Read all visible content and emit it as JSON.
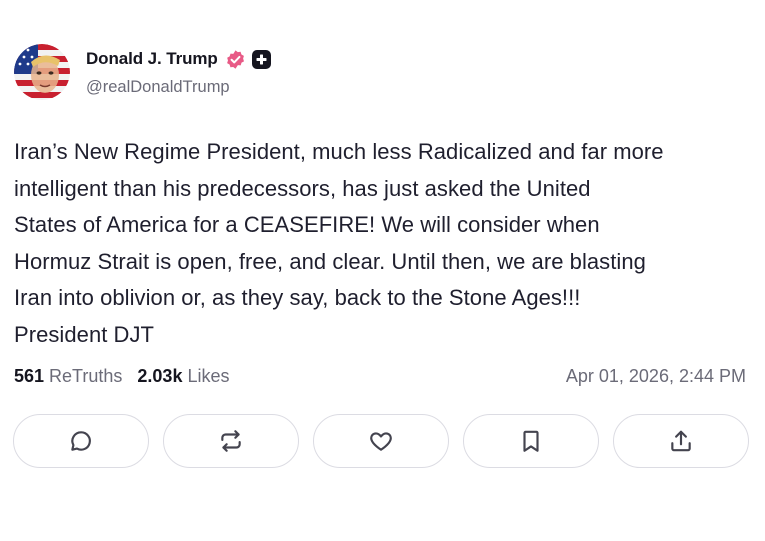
{
  "author": {
    "display_name": "Donald J. Trump",
    "handle": "@realDonaldTrump",
    "verified_icon": "verified-badge-icon",
    "plus_icon": "plus-badge-icon"
  },
  "post": {
    "lines": [
      "Iran’s New Regime President, much less Radicalized and far more",
      "intelligent than his predecessors, has just asked the United",
      "States of America for a CEASEFIRE! We will consider when",
      "Hormuz Strait is open, free, and clear. Until then, we are blasting",
      "Iran into oblivion or, as they say, back to the Stone Ages!!!",
      "President DJT"
    ]
  },
  "stats": {
    "retruths_count": "561",
    "retruths_label": "ReTruths",
    "likes_count": "2.03k",
    "likes_label": "Likes",
    "timestamp": "Apr 01, 2026, 2:44 PM"
  },
  "actions": [
    "reply-icon",
    "retruth-icon",
    "like-icon",
    "bookmark-icon",
    "share-icon"
  ],
  "colors": {
    "text": "#1f1f2e",
    "muted": "#6b6b78",
    "verified": "#e85a86",
    "border": "#dcdce3"
  }
}
